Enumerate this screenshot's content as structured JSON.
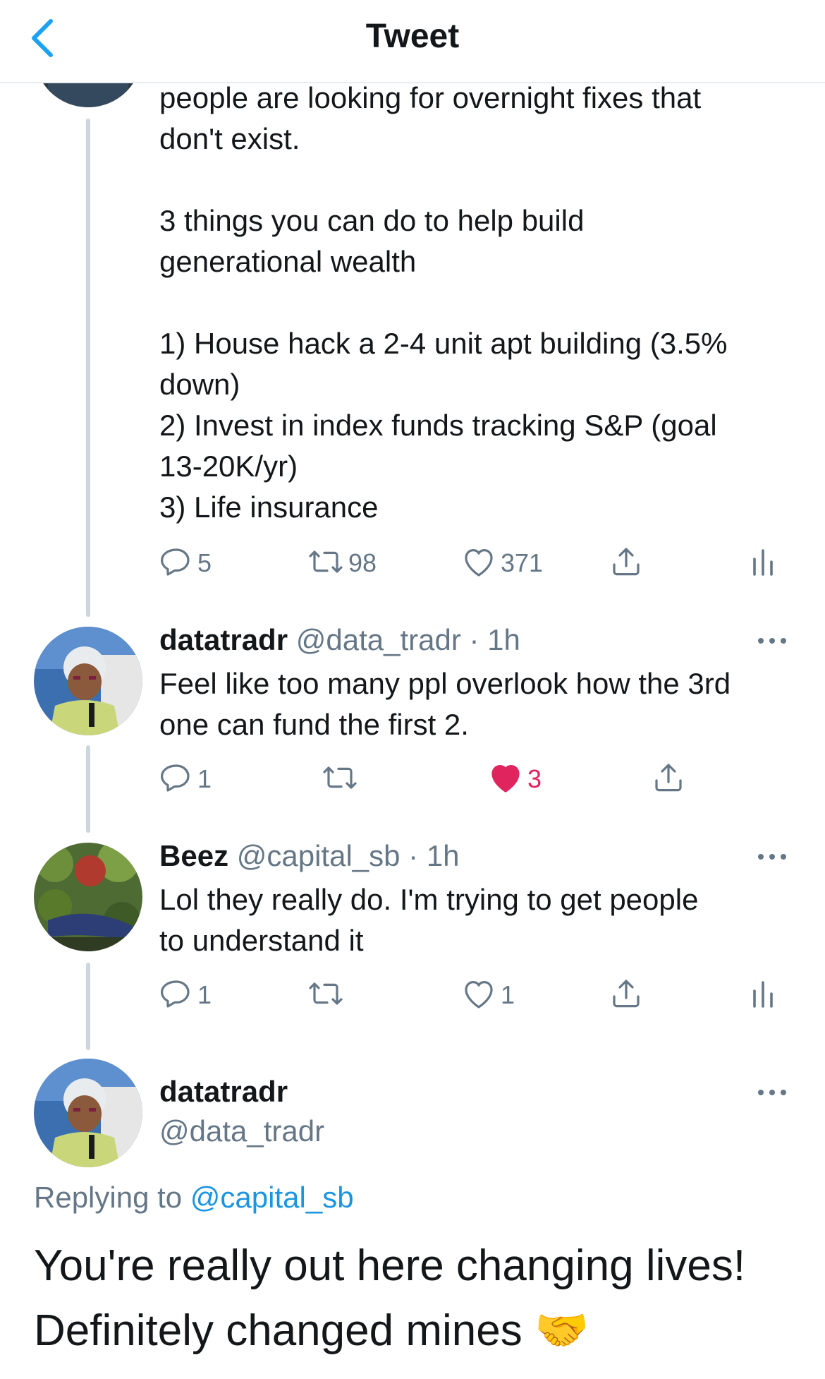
{
  "header": {
    "title": "Tweet"
  },
  "tweets": [
    {
      "body": "people are looking for overnight fixes that\ndon't exist.\n\n3 things you can do to help build\ngenerational wealth\n\n1) House hack a 2-4 unit apt building (3.5%\ndown)\n2) Invest in index funds tracking S&P (goal\n13-20K/yr)\n3) Life insurance",
      "replies": "5",
      "retweets": "98",
      "likes": "371"
    },
    {
      "name": "datatradr",
      "handle": "@data_tradr",
      "dot": " · ",
      "time": "1h",
      "body": "Feel like too many ppl overlook how the 3rd\none can fund the first 2.",
      "replies": "1",
      "retweets": "",
      "likes": "3",
      "liked": true
    },
    {
      "name": "Beez",
      "handle": "@capital_sb",
      "dot": " · ",
      "time": "1h",
      "body": "Lol they really do. I'm trying to get people\nto understand it",
      "replies": "1",
      "retweets": "",
      "likes": "1"
    }
  ],
  "main": {
    "name": "datatradr",
    "handle": "@data_tradr",
    "replying_prefix": "Replying to ",
    "replying_to": "@capital_sb",
    "text": "You're really out here changing lives! Definitely changed mines 🤝"
  },
  "colors": {
    "accent": "#1da1f2",
    "like": "#e0245e",
    "muted": "#657786",
    "thread_line": "#ccd6dd"
  },
  "icons": [
    "back-chevron-icon",
    "reply-icon",
    "retweet-icon",
    "like-icon",
    "share-icon",
    "analytics-icon",
    "more-icon"
  ]
}
